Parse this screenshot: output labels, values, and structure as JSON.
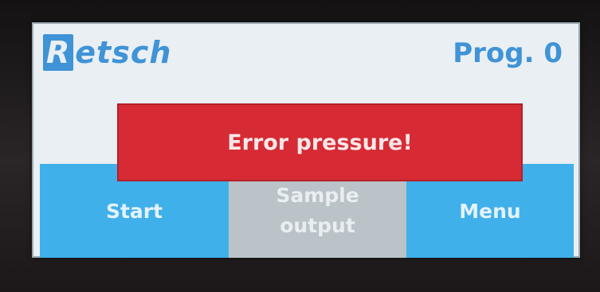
{
  "header": {
    "logo_first": "R",
    "logo_rest": "etsch",
    "program": "Prog. 0"
  },
  "error": {
    "message": "Error pressure!"
  },
  "buttons": {
    "start": "Start",
    "sample_line1": "Sample",
    "sample_line2": "output",
    "menu": "Menu"
  },
  "colors": {
    "screen_bg": "#e9eff3",
    "brand_blue": "#3f93d6",
    "button_blue": "#3fb0ea",
    "button_disabled": "#b9c3c8",
    "error_red": "#d62b34"
  }
}
